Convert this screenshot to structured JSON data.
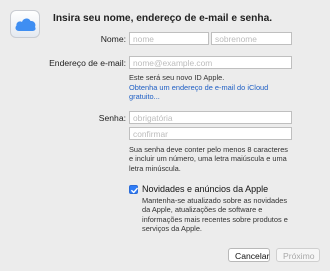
{
  "header": {
    "title": "Insira seu nome, endereço de e-mail e senha.",
    "icon": "icloud-icon"
  },
  "name": {
    "label": "Nome:",
    "first_placeholder": "nome",
    "last_placeholder": "sobrenome"
  },
  "email": {
    "label": "Endereço de e-mail:",
    "placeholder": "nome@example.com",
    "hint": "Este será seu novo ID Apple.",
    "link_line1": "Obtenha um endereço de e-mail do iCloud",
    "link_line2": "gratuito..."
  },
  "password": {
    "label": "Senha:",
    "placeholder": "obrigatória",
    "confirm_placeholder": "confirmar",
    "hint_line1": "Sua senha deve conter pelo menos 8 caracteres",
    "hint_line2": "e incluir um número, uma letra maiúscula e uma",
    "hint_line3": "letra minúscula."
  },
  "newsletter": {
    "label": "Novidades e anúncios da Apple",
    "checked": true,
    "desc_line1": "Mantenha-se atualizado sobre as novidades",
    "desc_line2": "da Apple, atualizações de software e",
    "desc_line3": "informações mais recentes sobre produtos e",
    "desc_line4": "serviços da Apple."
  },
  "buttons": {
    "cancel": "Cancelar",
    "next": "Próximo"
  },
  "colors": {
    "accent": "#2f7cf6",
    "link": "#1f5fc4",
    "background": "#ececec"
  }
}
